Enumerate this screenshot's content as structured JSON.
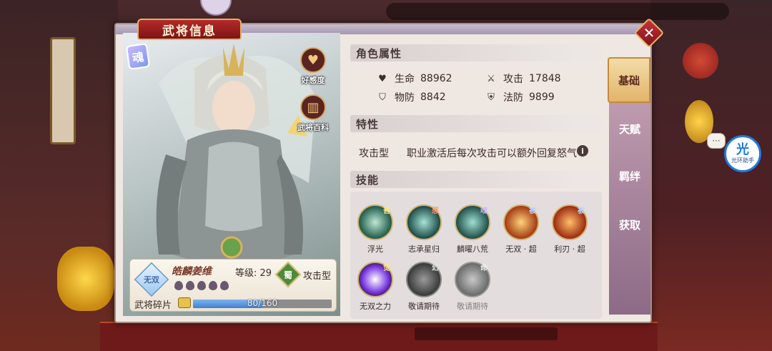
{
  "window": {
    "title": "武将信息",
    "close_symbol": "✕"
  },
  "hero": {
    "soul_badge": "魂",
    "favor_label": "好感度",
    "wiki_label": "武将百科",
    "quality_badge": "无双",
    "name": "皓麟姜维",
    "level_text": "等级: 29",
    "faction": "蜀",
    "type": "攻击型",
    "fragments_label": "武将碎片",
    "fragments_current": 80,
    "fragments_total": 160,
    "fragments_text": "80/160"
  },
  "attributes": {
    "header": "角色属性",
    "hp_label": "生命",
    "hp_value": "88962",
    "atk_label": "攻击",
    "atk_value": "17848",
    "pdef_label": "物防",
    "pdef_value": "8842",
    "mdef_label": "法防",
    "mdef_value": "9899"
  },
  "trait": {
    "header": "特性",
    "type": "攻击型",
    "description": "职业激活后每次攻击可以额外回复怒气",
    "info_symbol": "i"
  },
  "skills": {
    "header": "技能",
    "items": [
      {
        "name": "浮光",
        "tag": "普"
      },
      {
        "name": "志承星归",
        "tag": "怒"
      },
      {
        "name": "麟曜八荒",
        "tag": "魂"
      },
      {
        "name": "无双 · 超",
        "tag": "被"
      },
      {
        "name": "利刃 · 超",
        "tag": "被"
      },
      {
        "name": "无双之力",
        "tag": "觉"
      },
      {
        "name": "敬请期待",
        "tag": "幻"
      },
      {
        "name": "敬请期待",
        "tag": "命"
      }
    ]
  },
  "side_tabs": {
    "basic": "基础",
    "talent": "天赋",
    "bond": "羁绊",
    "obtain": "获取"
  },
  "helper": {
    "glyph": "光",
    "label": "光环助手"
  },
  "chat_symbol": "···"
}
